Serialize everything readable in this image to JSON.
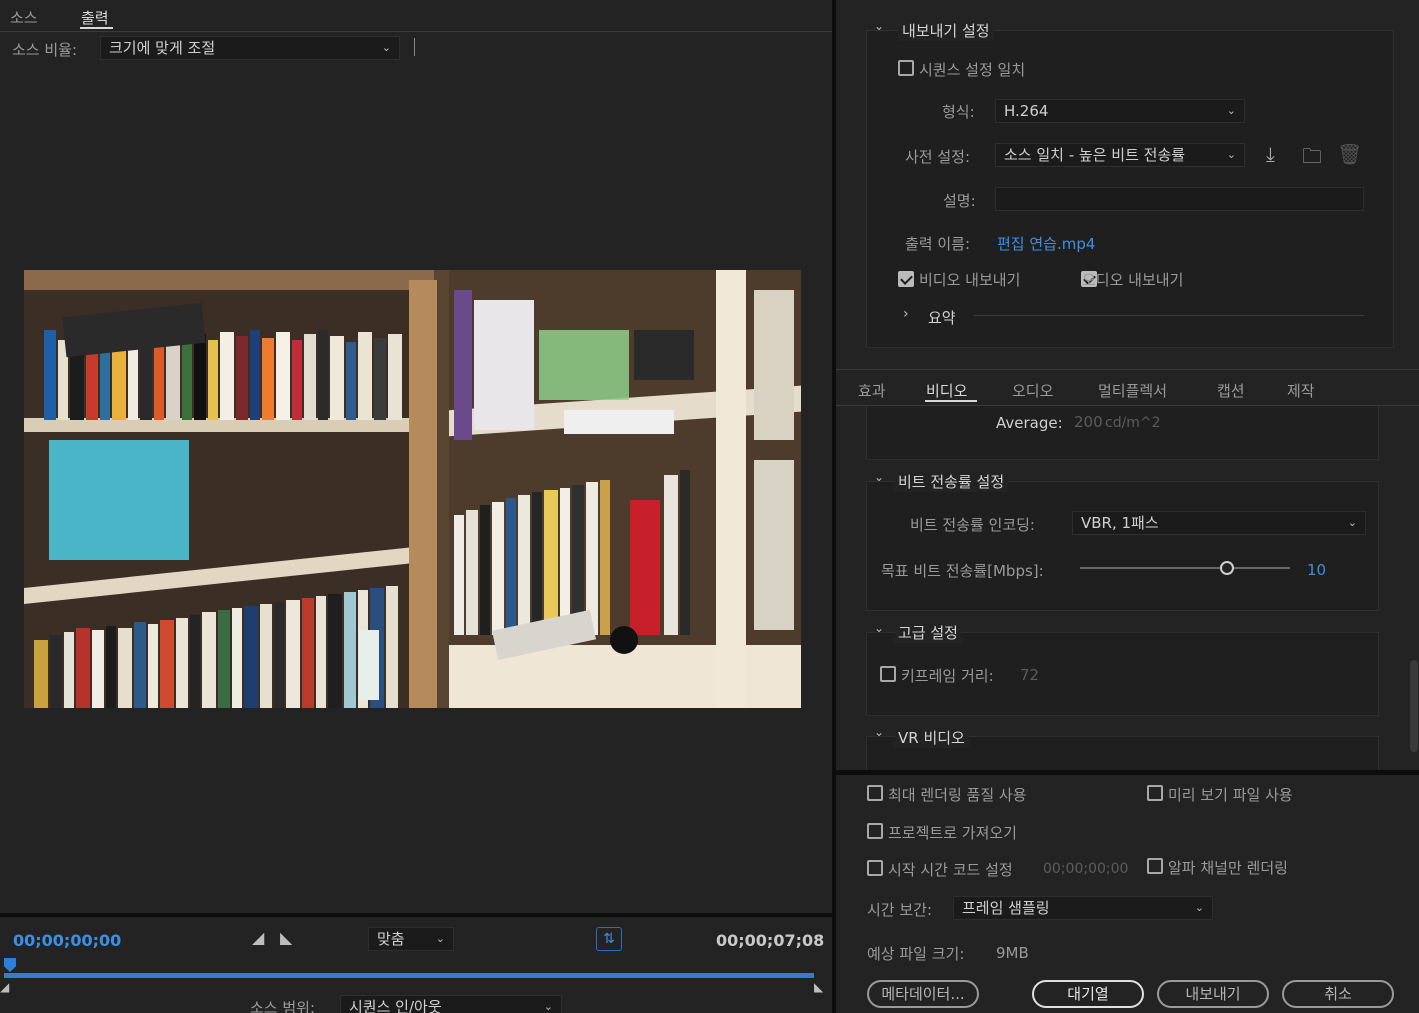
{
  "left": {
    "tabs": [
      "소스",
      "출력"
    ],
    "active_tab": 1,
    "source_ratio_label": "소스 비율:",
    "source_ratio_value": "크기에 맞게 조절",
    "timecode_start": "00;00;00;00",
    "timecode_end": "00;00;07;08",
    "fit_value": "맞춤",
    "source_range_label": "소스 범위:",
    "source_range_value": "시퀀스 인/아웃"
  },
  "export": {
    "section_title": "내보내기 설정",
    "match_sequence": "시퀀스 설정 일치",
    "format_label": "형식:",
    "format_value": "H.264",
    "preset_label": "사전 설정:",
    "preset_value": "소스 일치 - 높은 비트 전송률",
    "comment_label": "설명:",
    "comment_value": "",
    "output_name_label": "출력 이름:",
    "output_name_value": "편집 연습.mp4",
    "export_video": "비디오 내보내기",
    "export_audio": "오디오 내보내기",
    "summary": "요약"
  },
  "tabs": {
    "items": [
      "효과",
      "비디오",
      "오디오",
      "멀티플렉서",
      "캡션",
      "제작"
    ],
    "active": 1
  },
  "video": {
    "average_label": "Average:",
    "average_value": "200",
    "average_unit": "cd/m^2",
    "bitrate_title": "비트 전송률 설정",
    "encoding_label": "비트 전송률 인코딩:",
    "encoding_value": "VBR, 1패스",
    "target_label": "목표 비트 전송률[Mbps]:",
    "target_value": "10",
    "target_fraction": 0.7,
    "advanced_title": "고급 설정",
    "keyframe_label": "키프레임 거리:",
    "keyframe_value": "72",
    "vr_title": "VR 비디오"
  },
  "bottom": {
    "max_render": "최대 렌더링 품질 사용",
    "use_preview": "미리 보기 파일 사용",
    "import_project": "프로젝트로 가져오기",
    "start_timecode": "시작 시간 코드 설정",
    "start_timecode_value": "00;00;00;00",
    "alpha_only": "알파 채널만 렌더링",
    "time_interp_label": "시간 보간:",
    "time_interp_value": "프레임 샘플링",
    "file_size_label": "예상 파일 크기:",
    "file_size_value": "9MB",
    "btn_metadata": "메타데이터...",
    "btn_queue": "대기열",
    "btn_export": "내보내기",
    "btn_cancel": "취소"
  }
}
